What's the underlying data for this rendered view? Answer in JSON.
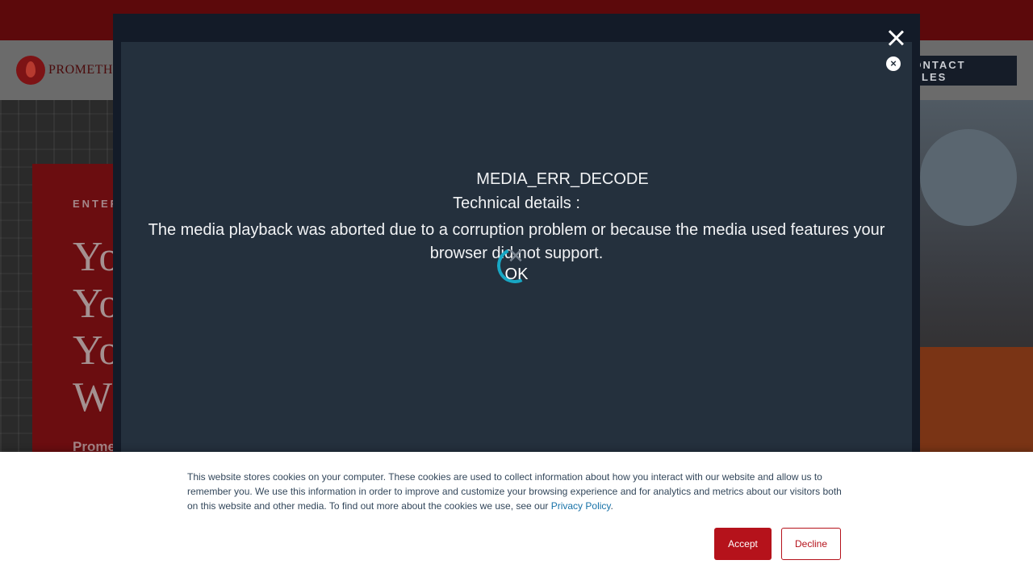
{
  "header": {
    "logo_text": "PROMETHEUS",
    "contact_label": "CONTACT SALES"
  },
  "hero": {
    "eyebrow": "ENTERPRISE",
    "lines": [
      "Yo",
      "Yo",
      "Yo",
      "W"
    ],
    "subtitle": "Prome"
  },
  "video_modal": {
    "error_code": "MEDIA_ERR_DECODE",
    "details_label": "Technical details :",
    "message": "The media playback was aborted due to a corruption problem or because the media used features your browser did not support.",
    "ok_label": "OK",
    "close_symbol": "×"
  },
  "cookie_banner": {
    "text": "This website stores cookies on your computer. These cookies are used to collect information about how you interact with our website and allow us to remember you. We use this information in order to improve and customize your browsing experience and for analytics and metrics about our visitors both on this website and other media. To find out more about the cookies we use, see our ",
    "link_label": "Privacy Policy",
    "link_suffix": ".",
    "accept_label": "Accept",
    "decline_label": "Decline"
  },
  "colors": {
    "brand_red": "#b5121b",
    "topbar": "#5c090b",
    "modal_bg": "#24303d",
    "spinner": "#18a7c4",
    "link": "#1772a8"
  },
  "icons": {
    "modal_close": "close-icon",
    "player_close": "close-circle-icon",
    "spinner": "loading-spinner-icon"
  }
}
